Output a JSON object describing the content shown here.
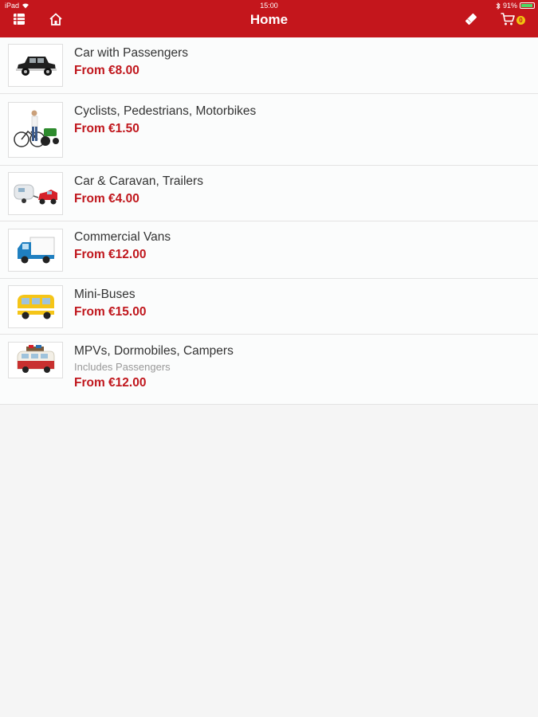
{
  "status_bar": {
    "device": "iPad",
    "time": "15:00",
    "battery": "91%"
  },
  "header": {
    "title": "Home",
    "cart_count": "0",
    "icons": [
      "menu-icon",
      "home-icon",
      "ticket-icon",
      "cart-icon"
    ]
  },
  "colors": {
    "brand": "#c4161c",
    "price": "#c0171d",
    "badge": "#f1c40f"
  },
  "items": [
    {
      "title": "Car with Passengers",
      "price": "From €8.00",
      "image": "car-icon"
    },
    {
      "title": "Cyclists, Pedestrians, Motorbikes",
      "price": "From €1.50",
      "image": "cyclist-icon"
    },
    {
      "title": "Car & Caravan, Trailers",
      "price": "From €4.00",
      "image": "caravan-icon"
    },
    {
      "title": "Commercial Vans",
      "price": "From €12.00",
      "image": "van-icon"
    },
    {
      "title": "Mini-Buses",
      "price": "From €15.00",
      "image": "minibus-icon"
    },
    {
      "title": "MPVs, Dormobiles, Campers",
      "subtitle": "Includes Passengers",
      "price": "From €12.00",
      "image": "camper-icon"
    }
  ]
}
